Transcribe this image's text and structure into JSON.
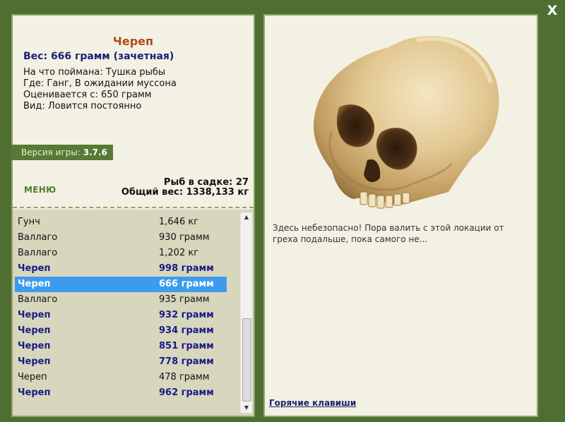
{
  "window": {
    "close_label": "X"
  },
  "fish": {
    "name": "Череп",
    "weight_line": "Вес: 666 грамм (зачетная)",
    "info": [
      "На что поймана: Тушка рыбы",
      "Где: Ганг, В ожидании муссона",
      "Оценивается с: 650 грамм",
      "Вид: Ловится постоянно"
    ]
  },
  "version": {
    "label": "Версия игры:",
    "value": "3.7.6"
  },
  "menu_label": "МЕНЮ",
  "stats": {
    "fish_count": "Рыб в садке: 27",
    "total_weight": "Общий вес: 1338,133 кг"
  },
  "catch_list": [
    {
      "name": "Гунч",
      "weight": "1,646 кг",
      "style": "normal"
    },
    {
      "name": "Валлаго",
      "weight": "930 грамм",
      "style": "normal"
    },
    {
      "name": "Валлаго",
      "weight": "1,202 кг",
      "style": "normal"
    },
    {
      "name": "Череп",
      "weight": "998 грамм",
      "style": "bold"
    },
    {
      "name": "Череп",
      "weight": "666 грамм",
      "style": "selected"
    },
    {
      "name": "Валлаго",
      "weight": "935 грамм",
      "style": "normal"
    },
    {
      "name": "Череп",
      "weight": "932 грамм",
      "style": "bold"
    },
    {
      "name": "Череп",
      "weight": "934 грамм",
      "style": "bold"
    },
    {
      "name": "Череп",
      "weight": "851 грамм",
      "style": "bold"
    },
    {
      "name": "Череп",
      "weight": "778 грамм",
      "style": "bold"
    },
    {
      "name": "Череп",
      "weight": "478 грамм",
      "style": "normal"
    },
    {
      "name": "Череп",
      "weight": "962 грамм",
      "style": "bold"
    }
  ],
  "description": "Здесь небезопасно! Пора валить с этой локации от греха подальше, пока самого не...",
  "hotkeys_label": "Горячие клавиши",
  "colors": {
    "background": "#4f6f32",
    "panel": "#f3f1e3",
    "list_background": "#d8d6bd",
    "selection": "#3d9bee",
    "title": "#b04a1c",
    "highlight_text": "#1a1a86"
  }
}
